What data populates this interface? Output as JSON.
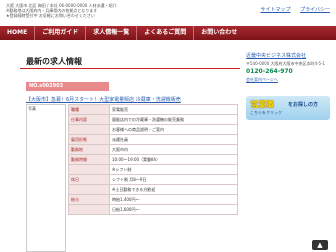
{
  "header": {
    "lines": [
      "大阪 大阪市 北区 梅田 / 本社 06-0000-0000 人材派遣・紹介",
      "※勤務地は大阪府内・兵庫県内の各拠点となります",
      "★登録随時受付中 お気軽にお問い合わせください"
    ],
    "links": [
      "サイトマップ",
      "プライバシー"
    ]
  },
  "nav": {
    "items": [
      "HOME",
      "ご利用ガイド",
      "求人情報一覧",
      "よくあるご質問",
      "お問い合わせ"
    ]
  },
  "main": {
    "title": "最新の求人情報",
    "job_no": "NO.s002903",
    "job_title": "【大阪市】急募！6月スタート！大型家電量販店 冷蔵庫・洗濯機販売",
    "photo_label": "写真",
    "rows": [
      {
        "key": "職種",
        "value": "家電販売"
      },
      {
        "key": "仕事内容",
        "value": "量販店内での冷蔵庫・洗濯機の販売業務"
      },
      {
        "key": "",
        "value": "お客様への商品説明・ご案内"
      },
      {
        "key": "雇用形態",
        "value": "派遣社員"
      },
      {
        "key": "勤務地",
        "value": "大阪市内"
      },
      {
        "key": "勤務時間",
        "value": "10:00〜19:00（実働8h）"
      },
      {
        "key": "",
        "value": "※シフト制"
      },
      {
        "key": "休日",
        "value": "シフト制 月8〜9日"
      },
      {
        "key": "",
        "value": "※土日勤務できる方歓迎"
      },
      {
        "key": "給与",
        "value": "時給1,400円〜"
      },
      {
        "key": "",
        "value": "日給1,600円〜"
      }
    ]
  },
  "sidebar": {
    "company": "近畿中央ビジネス株式会社",
    "address": "〒540-0000 大阪府大阪市中央区本町4-5-1",
    "tel": "0120-264-970",
    "link": "会社案内ページへ"
  },
  "banner": {
    "main": "営業職",
    "sub": "をお探しの方",
    "note": "こちらをクリック"
  },
  "colors": {
    "nav": "#8f1b20",
    "accent": "#c22222",
    "link": "#2a5db0"
  }
}
